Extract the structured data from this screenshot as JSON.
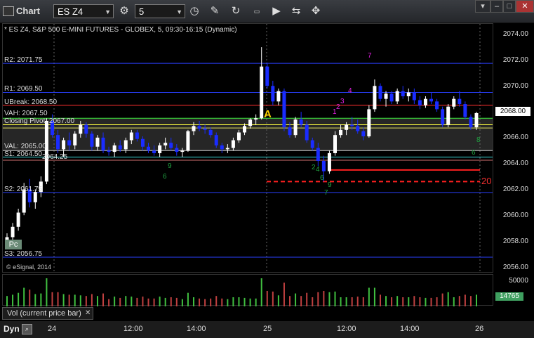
{
  "window": {
    "title": "Chart",
    "symbol": "ES Z4",
    "interval": "5",
    "header_line": "* ES Z4, S&P 500 E-MINI FUTURES - GLOBEX, 5, 09:30-16:15 (Dynamic)"
  },
  "levels": {
    "r2": "R2: 2071.75",
    "r1": "R1: 2069.50",
    "ubreak": "UBreak: 2068.50",
    "vah": "VAH: 2067.50",
    "closing_pivot": "Closing Pivot: 2067.00",
    "val": "VAL: 2065.00",
    "s1": "S1: 2064.50",
    "s1_extra": "2064.25",
    "s2": "S2: 2061.75",
    "s3": "S3: 2056.75"
  },
  "price_axis": [
    "2074.00",
    "2072.00",
    "2070.00",
    "2068.00",
    "2066.00",
    "2064.00",
    "2062.00",
    "2060.00",
    "2058.00",
    "2056.00"
  ],
  "current_price": "2068.00",
  "annotations": {
    "a_marker": "A",
    "pc_label": "Pc",
    "twenty_label": "20",
    "copyright": "© eSignal, 2014"
  },
  "volume": {
    "label": "Vol (current price bar)",
    "axis_top": "50000",
    "current": "14765"
  },
  "time_axis": [
    "24",
    "12:00",
    "14:00",
    "25",
    "12:00",
    "14:00",
    "26"
  ],
  "bottom": {
    "dyn": "Dyn"
  },
  "colors": {
    "up": "#ffffff",
    "down": "#1a2cff",
    "r_level": "#2a3fff",
    "ubreak": "#ff3030",
    "vah": "#3cf03c",
    "pivot": "#ffff40",
    "s_level": "#40e0e0",
    "seq_magenta": "#e020e0",
    "seq_green": "#20a040"
  },
  "chart_data": {
    "type": "candlestick",
    "ylim": [
      2055.5,
      2074.8
    ],
    "candles": [
      [
        2058.0,
        2058.6,
        2057.4,
        2058.3
      ],
      [
        2058.3,
        2059.4,
        2058.0,
        2059.1
      ],
      [
        2059.1,
        2060.5,
        2058.8,
        2060.2
      ],
      [
        2060.2,
        2062.5,
        2060.0,
        2062.0
      ],
      [
        2062.0,
        2062.8,
        2060.6,
        2061.0
      ],
      [
        2061.0,
        2062.0,
        2060.5,
        2061.8
      ],
      [
        2061.8,
        2063.0,
        2061.4,
        2062.6
      ],
      [
        2062.6,
        2067.5,
        2062.4,
        2067.3
      ],
      [
        2067.3,
        2067.8,
        2066.0,
        2066.2
      ],
      [
        2066.2,
        2066.6,
        2064.8,
        2065.1
      ],
      [
        2065.1,
        2066.0,
        2064.5,
        2065.8
      ],
      [
        2065.8,
        2066.4,
        2065.0,
        2065.4
      ],
      [
        2065.4,
        2066.5,
        2065.1,
        2066.3
      ],
      [
        2066.3,
        2067.3,
        2066.0,
        2067.0
      ],
      [
        2067.0,
        2067.2,
        2066.0,
        2066.3
      ],
      [
        2066.3,
        2066.5,
        2065.0,
        2065.3
      ],
      [
        2065.3,
        2066.2,
        2065.0,
        2066.0
      ],
      [
        2066.0,
        2066.4,
        2064.8,
        2065.0
      ],
      [
        2065.0,
        2065.3,
        2064.6,
        2064.9
      ],
      [
        2064.9,
        2065.6,
        2064.5,
        2065.4
      ],
      [
        2065.4,
        2065.8,
        2064.9,
        2065.1
      ],
      [
        2065.1,
        2066.0,
        2064.8,
        2065.8
      ],
      [
        2065.8,
        2066.6,
        2065.5,
        2066.4
      ],
      [
        2066.4,
        2066.6,
        2065.7,
        2065.9
      ],
      [
        2065.9,
        2066.1,
        2065.0,
        2065.3
      ],
      [
        2065.3,
        2065.6,
        2064.8,
        2065.0
      ],
      [
        2065.0,
        2065.4,
        2064.6,
        2064.8
      ],
      [
        2064.8,
        2065.6,
        2064.5,
        2065.4
      ],
      [
        2065.4,
        2066.0,
        2065.1,
        2065.6
      ],
      [
        2065.6,
        2066.0,
        2065.0,
        2065.2
      ],
      [
        2065.2,
        2065.5,
        2064.6,
        2064.9
      ],
      [
        2064.9,
        2065.2,
        2064.5,
        2065.0
      ],
      [
        2065.0,
        2066.6,
        2064.9,
        2066.5
      ],
      [
        2066.5,
        2067.2,
        2066.2,
        2066.9
      ],
      [
        2066.9,
        2067.3,
        2066.5,
        2066.7
      ],
      [
        2066.7,
        2067.0,
        2066.3,
        2066.6
      ],
      [
        2066.6,
        2066.8,
        2066.0,
        2066.2
      ],
      [
        2066.2,
        2066.4,
        2065.2,
        2065.4
      ],
      [
        2065.4,
        2065.6,
        2064.8,
        2065.1
      ],
      [
        2065.1,
        2065.5,
        2064.8,
        2065.2
      ],
      [
        2065.2,
        2066.0,
        2065.0,
        2065.8
      ],
      [
        2065.8,
        2066.6,
        2065.6,
        2066.4
      ],
      [
        2066.4,
        2067.1,
        2066.2,
        2066.9
      ],
      [
        2066.9,
        2067.5,
        2066.7,
        2067.4
      ],
      [
        2067.4,
        2067.8,
        2067.0,
        2067.5
      ],
      [
        2067.5,
        2073.0,
        2067.4,
        2071.5
      ],
      [
        2071.5,
        2071.8,
        2069.8,
        2070.0
      ],
      [
        2070.0,
        2070.4,
        2068.5,
        2068.8
      ],
      [
        2068.8,
        2069.8,
        2068.5,
        2069.6
      ],
      [
        2069.6,
        2069.8,
        2066.5,
        2066.8
      ],
      [
        2066.8,
        2067.2,
        2066.0,
        2066.2
      ],
      [
        2066.2,
        2067.6,
        2066.0,
        2067.4
      ],
      [
        2067.4,
        2068.0,
        2066.8,
        2067.0
      ],
      [
        2067.0,
        2067.3,
        2065.6,
        2065.8
      ],
      [
        2065.8,
        2066.0,
        2065.0,
        2065.2
      ],
      [
        2065.2,
        2065.6,
        2063.8,
        2064.2
      ],
      [
        2064.2,
        2064.6,
        2062.6,
        2063.4
      ],
      [
        2063.4,
        2065.0,
        2063.2,
        2064.8
      ],
      [
        2064.8,
        2066.5,
        2064.6,
        2066.2
      ],
      [
        2066.2,
        2067.0,
        2066.0,
        2066.6
      ],
      [
        2066.6,
        2067.2,
        2066.2,
        2067.0
      ],
      [
        2067.0,
        2067.6,
        2066.6,
        2066.9
      ],
      [
        2066.9,
        2067.4,
        2066.3,
        2066.5
      ],
      [
        2066.5,
        2066.8,
        2065.8,
        2066.1
      ],
      [
        2066.1,
        2068.5,
        2066.0,
        2068.2
      ],
      [
        2068.2,
        2070.5,
        2068.0,
        2070.0
      ],
      [
        2070.0,
        2070.2,
        2068.8,
        2069.0
      ],
      [
        2069.0,
        2069.6,
        2068.4,
        2069.4
      ],
      [
        2069.4,
        2069.6,
        2068.6,
        2068.8
      ],
      [
        2068.8,
        2069.8,
        2068.6,
        2069.6
      ],
      [
        2069.6,
        2070.0,
        2069.0,
        2069.2
      ],
      [
        2069.2,
        2069.8,
        2068.8,
        2069.5
      ],
      [
        2069.5,
        2069.8,
        2068.6,
        2068.9
      ],
      [
        2068.9,
        2069.2,
        2068.2,
        2068.5
      ],
      [
        2068.5,
        2069.2,
        2068.3,
        2069.0
      ],
      [
        2069.0,
        2069.5,
        2068.6,
        2068.8
      ],
      [
        2068.8,
        2069.0,
        2068.0,
        2068.2
      ],
      [
        2068.2,
        2068.4,
        2066.8,
        2067.0
      ],
      [
        2067.0,
        2068.6,
        2066.8,
        2068.4
      ],
      [
        2068.4,
        2069.2,
        2068.2,
        2069.0
      ],
      [
        2069.0,
        2069.6,
        2068.4,
        2068.6
      ],
      [
        2068.6,
        2068.8,
        2067.4,
        2067.6
      ],
      [
        2067.6,
        2067.8,
        2066.6,
        2066.8
      ],
      [
        2066.8,
        2068.0,
        2066.6,
        2067.9
      ]
    ],
    "volume_max": 50000
  }
}
